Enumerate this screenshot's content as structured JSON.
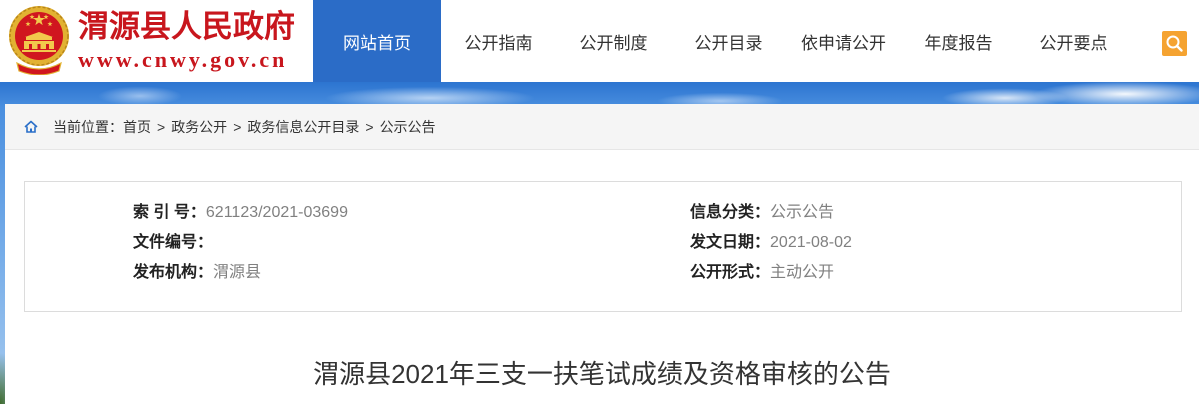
{
  "site": {
    "name": "渭源县人民政府",
    "domain": "www.cnwy.gov.cn"
  },
  "nav": {
    "items": [
      "网站首页",
      "公开指南",
      "公开制度",
      "公开目录",
      "依申请公开",
      "年度报告",
      "公开要点"
    ],
    "active_index": 0
  },
  "breadcrumb": {
    "prefix": "当前位置：",
    "items": [
      "首页",
      "政务公开",
      "政务信息公开目录",
      "公示公告"
    ],
    "separator": ">"
  },
  "info": {
    "index": {
      "label": "索 引 号：",
      "value": "621123/2021-03699"
    },
    "category": {
      "label": "信息分类：",
      "value": "公示公告"
    },
    "doc_number": {
      "label": "文件编号：",
      "value": ""
    },
    "issue_date": {
      "label": "发文日期：",
      "value": "2021-08-02"
    },
    "publisher": {
      "label": "发布机构：",
      "value": "渭源县"
    },
    "disclosure_form": {
      "label": "公开形式：",
      "value": "主动公开"
    }
  },
  "article": {
    "title": "渭源县2021年三支一扶笔试成绩及资格审核的公告"
  },
  "icons": {
    "logo": "national-emblem-icon",
    "search": "search-icon",
    "home": "home-icon"
  },
  "colors": {
    "brand_red": "#c8161d",
    "nav_active": "#2b6cc7",
    "search_accent": "#f5a331",
    "label": "#222222",
    "value": "#808080"
  }
}
